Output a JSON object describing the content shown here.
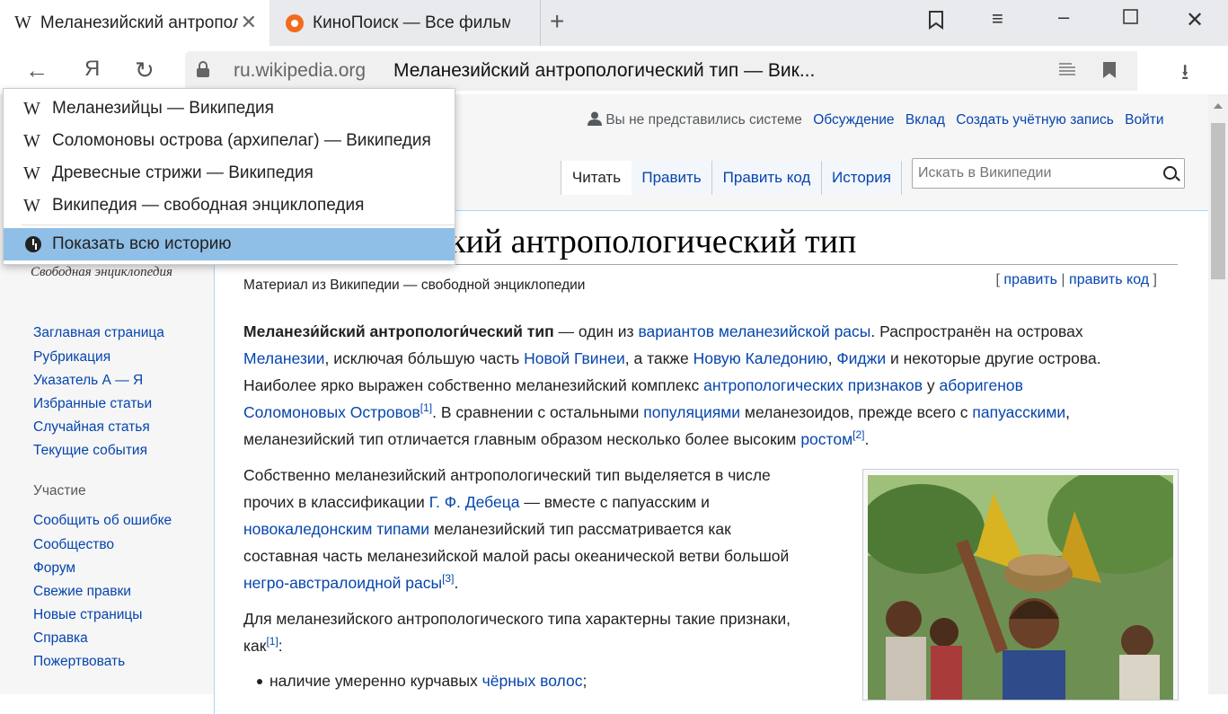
{
  "browser": {
    "tabs": [
      {
        "title": "Меланезийский антропологический тип — Википедия"
      },
      {
        "title": "КиноПоиск — Все фильмы планеты"
      }
    ],
    "address_domain": "ru.wikipedia.org",
    "address_title": "Меланезийский антропологический тип — Вик...",
    "yandex_label": "Я",
    "dropdown": {
      "items": [
        "Меланезийцы — Википедия",
        "Соломоновы острова (архипелаг) — Википедия",
        "Древесные стрижи — Википедия",
        "Википедия — свободная энциклопедия"
      ],
      "history_label": "Показать всю историю"
    }
  },
  "wiki": {
    "logo_letter": "W",
    "tagline": "Свободная энциклопедия",
    "personal": {
      "not_logged": "Вы не представились системе",
      "links": [
        "Обсуждение",
        "Вклад",
        "Создать учётную запись",
        "Войти"
      ]
    },
    "tabs": [
      "Читать",
      "Править",
      "Править код",
      "История"
    ],
    "search_placeholder": "Искать в Википедии",
    "nav": [
      "Заглавная страница",
      "Рубрикация",
      "Указатель А — Я",
      "Избранные статьи",
      "Случайная статья",
      "Текущие события"
    ],
    "participation_heading": "Участие",
    "participation": [
      "Сообщить об ошибке",
      "Сообщество",
      "Форум",
      "Свежие правки",
      "Новые страницы",
      "Справка",
      "Пожертвовать"
    ],
    "heading_visible": "кий антропологический тип",
    "from_wiki": "Материал из Википедии — свободной энциклопедии",
    "edit": "править",
    "edit_code": "править код",
    "p1": {
      "bold": "Меланези́йский антропологи́ческий тип",
      "t1": " — один из ",
      "l1": "вариантов меланезийской расы",
      "t2": ". Распространён на островах",
      "l2": "Меланезии",
      "t3": ", исключая бо́льшую часть ",
      "l3": "Новой Гвинеи",
      "t4": ", а также ",
      "l4": "Новую Каледонию",
      "t5": ", ",
      "l5": "Фиджи",
      "t6": " и некоторые другие острова.",
      "t7": "Наиболее ярко выражен собственно меланезийский комплекс ",
      "l6": "антропологических признаков",
      "t8": " у ",
      "l7": "аборигенов",
      "l8": "Соломоновых Островов",
      "ref1": "[1]",
      "t9": ". В сравнении с остальными ",
      "l9": "популяциями",
      "t10": " меланезоидов, прежде всего с ",
      "l10": "папуасскими",
      "t11": ",",
      "t12": "меланезийский тип отличается главным образом несколько более высоким ",
      "l11": "ростом",
      "ref2": "[2]",
      "t13": "."
    },
    "p2": {
      "line1": "Собственно меланезийский антропологический тип выделяется в числе",
      "t1": "прочих в классификации ",
      "l1": "Г. Ф. Дебеца",
      "t2": " — вместе с папуасским и",
      "l2": "новокаледонским типами",
      "t3": " меланезийский тип рассматривается как",
      "line4": "составная часть меланезийской малой расы океанической ветви большой",
      "l3": "негро-австралоидной расы",
      "ref3": "[3]",
      "t4": "."
    },
    "p3": {
      "line1": "Для меланезийского антропологического типа характерны такие признаки,",
      "t1": "как",
      "ref": "[1]",
      "t2": ":"
    },
    "bullet": {
      "t1": "наличие умеренно курчавых ",
      "l1": "чёрных волос",
      "t2": ";"
    }
  }
}
